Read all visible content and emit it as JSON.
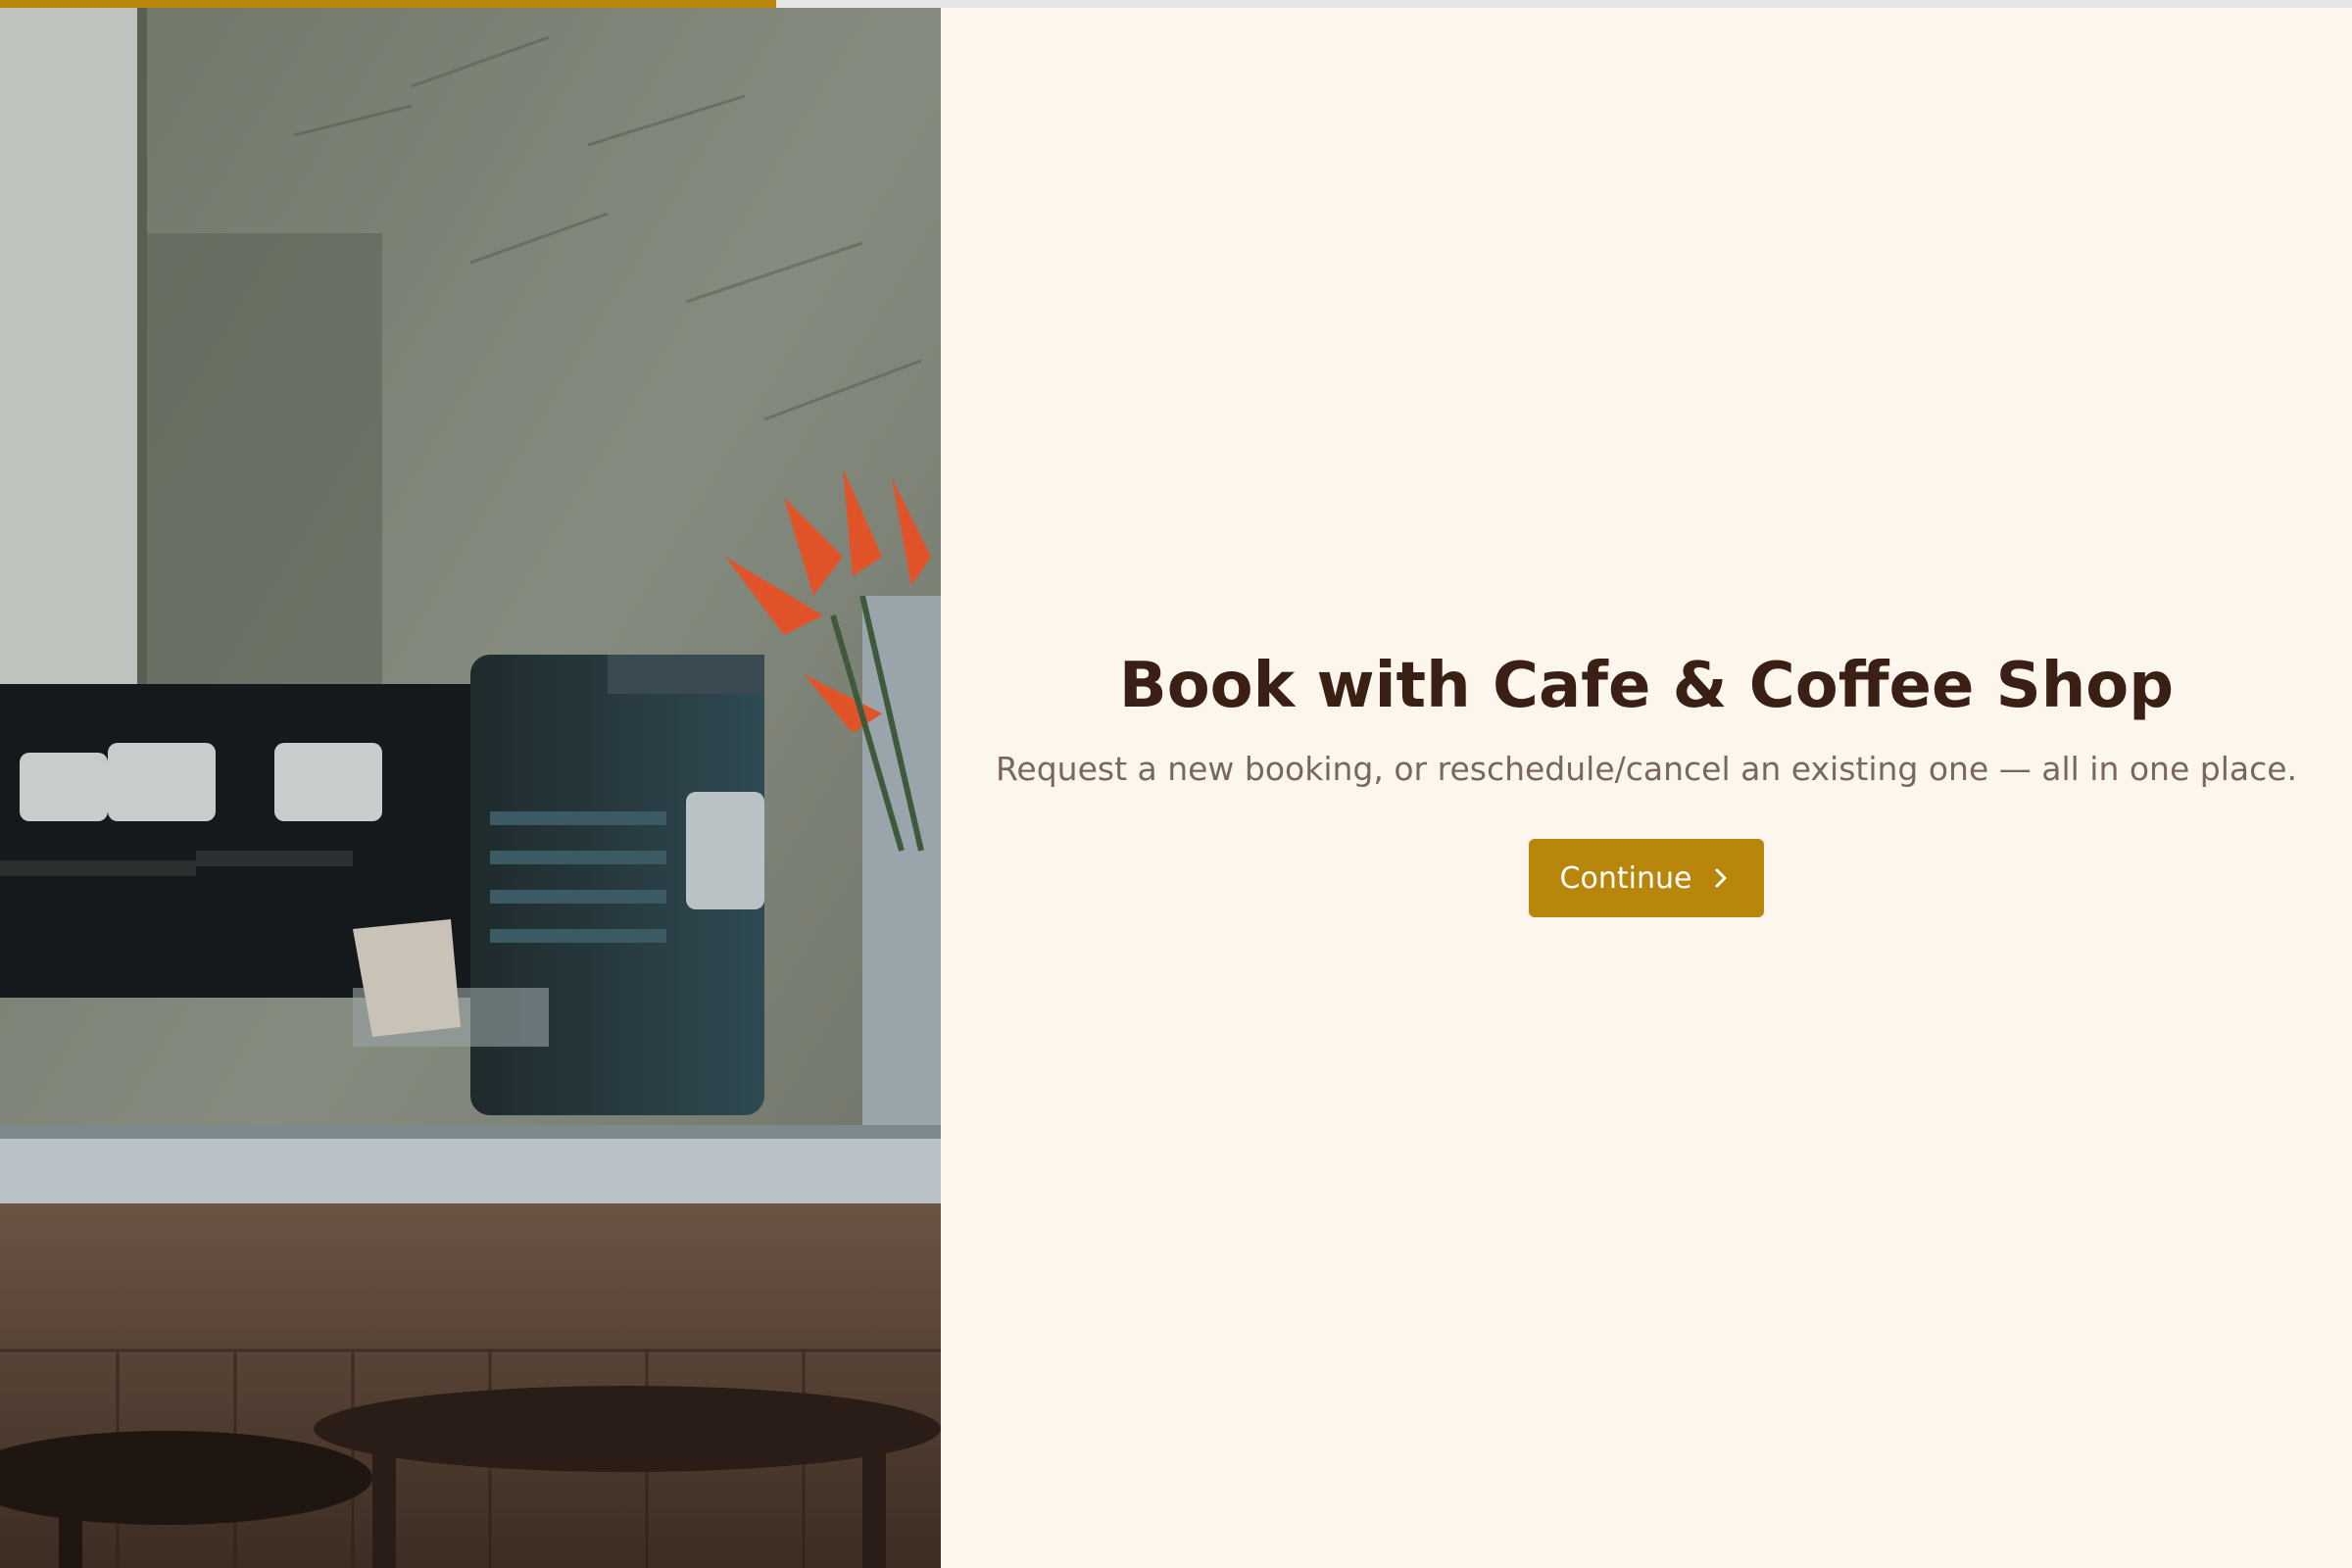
{
  "progress": {
    "fraction": 0.33,
    "color": "#b8860b"
  },
  "hero": {
    "image": "cafe-espresso-machine-photo"
  },
  "main": {
    "title": "Book with Cafe & Coffee Shop",
    "subtitle": "Request a new booking, or reschedule/cancel an existing one — all in one place.",
    "continue_label": "Continue",
    "continue_icon": "chevron-right-icon"
  },
  "colors": {
    "accent": "#b8860b",
    "background": "#fdf6ec",
    "title": "#3a1f14",
    "subtitle": "#7a675c"
  }
}
